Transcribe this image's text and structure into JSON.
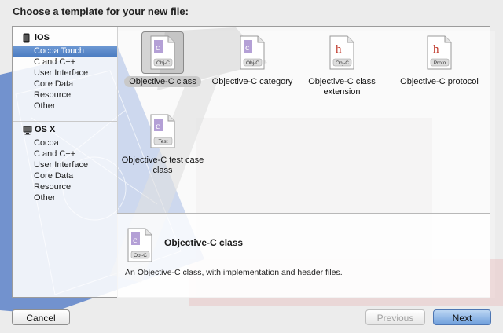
{
  "prompt": "Choose a template for your new file:",
  "sidebar": {
    "sections": [
      {
        "title": "iOS",
        "items": [
          "Cocoa Touch",
          "C and C++",
          "User Interface",
          "Core Data",
          "Resource",
          "Other"
        ],
        "selected": 0
      },
      {
        "title": "OS X",
        "items": [
          "Cocoa",
          "C and C++",
          "User Interface",
          "Core Data",
          "Resource",
          "Other"
        ],
        "selected": -1
      }
    ]
  },
  "templates": [
    {
      "label": "Objective-C class",
      "badge": "Obj-C",
      "glyph": "c",
      "selected": true
    },
    {
      "label": "Objective-C category",
      "badge": "Obj-C",
      "glyph": "c",
      "selected": false
    },
    {
      "label": "Objective-C class extension",
      "badge": "Obj-C",
      "glyph": "h",
      "selected": false
    },
    {
      "label": "Objective-C protocol",
      "badge": "Proto",
      "glyph": "h",
      "selected": false
    },
    {
      "label": "Objective-C test case class",
      "badge": "Test",
      "glyph": "c",
      "selected": false
    }
  ],
  "detail": {
    "title": "Objective-C class",
    "badge": "Obj-C",
    "glyph": "c",
    "description": "An Objective-C class, with implementation and header files."
  },
  "buttons": {
    "cancel": "Cancel",
    "previous": "Previous",
    "next": "Next"
  },
  "colors": {
    "accent": "#4c7dc2",
    "selection": "#6f9ad4"
  }
}
